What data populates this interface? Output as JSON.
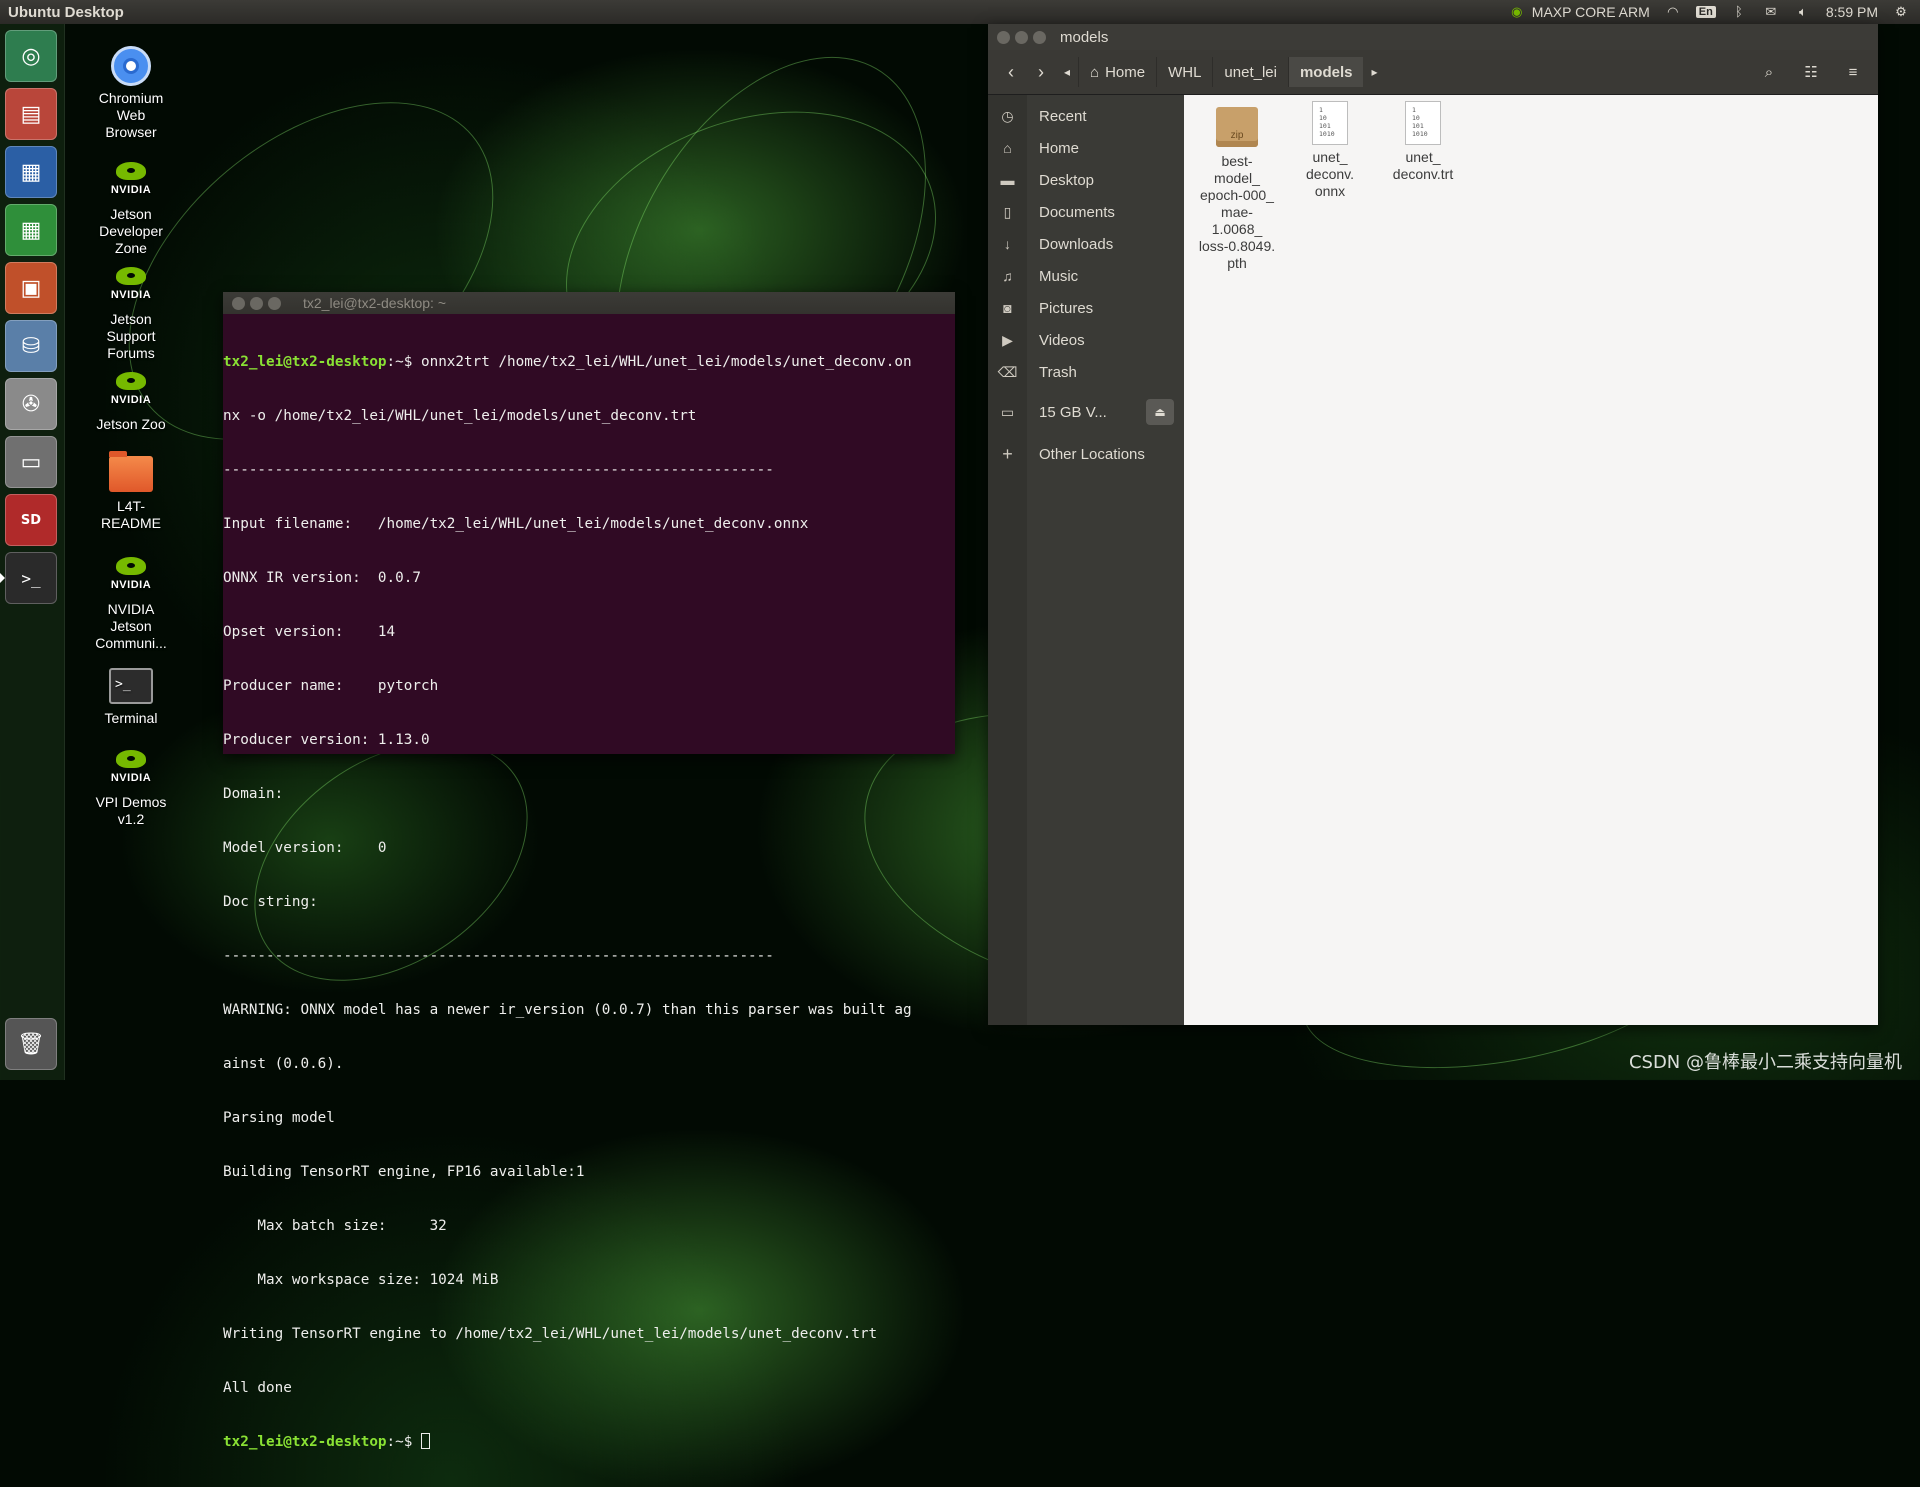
{
  "top_panel": {
    "title": "Ubuntu Desktop",
    "power_mode": "MAXP CORE ARM",
    "keyboard": "En",
    "time": "8:59 PM"
  },
  "desktop_icons": [
    {
      "lines": [
        "Chromium",
        "Web",
        "Browser"
      ]
    },
    {
      "lines": [
        "Jetson",
        "Developer",
        "Zone"
      ]
    },
    {
      "lines": [
        "Jetson",
        "Support",
        "Forums"
      ]
    },
    {
      "lines": [
        "Jetson Zoo"
      ]
    },
    {
      "lines": [
        "L4T-",
        "README"
      ]
    },
    {
      "lines": [
        "NVIDIA",
        "Jetson",
        "Communi..."
      ]
    },
    {
      "lines": [
        "Terminal"
      ]
    },
    {
      "lines": [
        "VPI Demos",
        "v1.2"
      ]
    }
  ],
  "nvidia_badge": "NVIDIA",
  "terminal": {
    "title": "tx2_lei@tx2-desktop: ~",
    "prompt": "tx2_lei@tx2-desktop",
    "prompt_suffix": ":~$ ",
    "command_line1": "onnx2trt /home/tx2_lei/WHL/unet_lei/models/unet_deconv.on",
    "lines": [
      "nx -o /home/tx2_lei/WHL/unet_lei/models/unet_deconv.trt",
      "----------------------------------------------------------------",
      "Input filename:   /home/tx2_lei/WHL/unet_lei/models/unet_deconv.onnx",
      "ONNX IR version:  0.0.7",
      "Opset version:    14",
      "Producer name:    pytorch",
      "Producer version: 1.13.0",
      "Domain:",
      "Model version:    0",
      "Doc string:",
      "----------------------------------------------------------------",
      "WARNING: ONNX model has a newer ir_version (0.0.7) than this parser was built ag",
      "ainst (0.0.6).",
      "Parsing model",
      "Building TensorRT engine, FP16 available:1",
      "    Max batch size:     32",
      "    Max workspace size: 1024 MiB",
      "Writing TensorRT engine to /home/tx2_lei/WHL/unet_lei/models/unet_deconv.trt",
      "All done"
    ]
  },
  "files": {
    "window_title": "models",
    "breadcrumbs": [
      "Home",
      "WHL",
      "unet_lei",
      "models"
    ],
    "sidebar": [
      {
        "label": "Recent",
        "icon": "clock-icon"
      },
      {
        "label": "Home",
        "icon": "home-icon"
      },
      {
        "label": "Desktop",
        "icon": "folder-icon"
      },
      {
        "label": "Documents",
        "icon": "document-icon"
      },
      {
        "label": "Downloads",
        "icon": "download-icon"
      },
      {
        "label": "Music",
        "icon": "music-icon"
      },
      {
        "label": "Pictures",
        "icon": "camera-icon"
      },
      {
        "label": "Videos",
        "icon": "video-icon"
      },
      {
        "label": "Trash",
        "icon": "trash-icon"
      }
    ],
    "volume": "15 GB V...",
    "other_locations": "Other Locations",
    "items": [
      {
        "lines": [
          "best-",
          "model_",
          "epoch-000_",
          "mae-",
          "1.0068_",
          "loss-0.8049.",
          "pth"
        ],
        "type": "zip",
        "badge": "zip"
      },
      {
        "lines": [
          "unet_",
          "deconv.",
          "onnx"
        ],
        "type": "binary"
      },
      {
        "lines": [
          "unet_",
          "deconv.trt"
        ],
        "type": "binary"
      }
    ],
    "binary_glyph": [
      "1",
      "10",
      "101",
      "1010"
    ]
  },
  "watermark": "CSDN @鲁棒最小二乘支持向量机"
}
